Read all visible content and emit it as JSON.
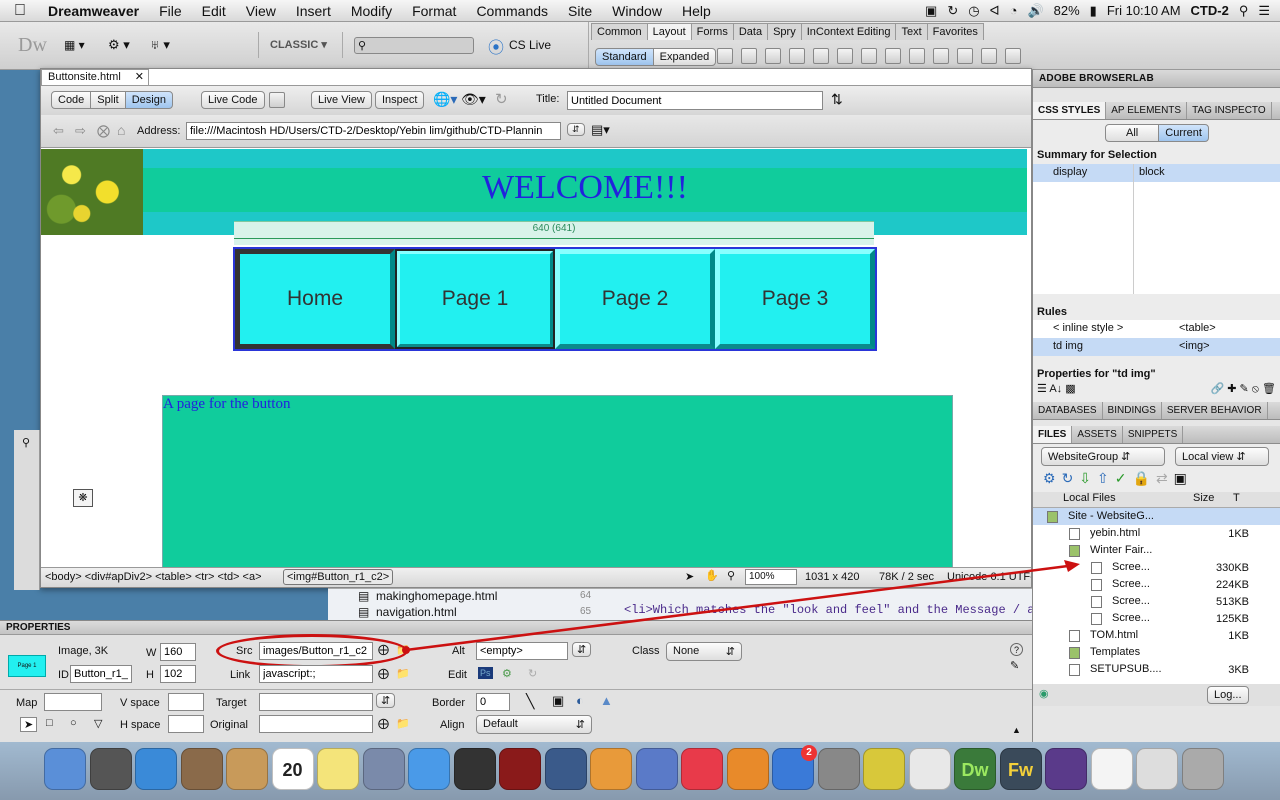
{
  "menubar": {
    "apple": "",
    "app": "Dreamweaver",
    "items": [
      "File",
      "Edit",
      "View",
      "Insert",
      "Modify",
      "Format",
      "Commands",
      "Site",
      "Window",
      "Help"
    ],
    "battery": "82%",
    "clock": "Fri 10:10 AM",
    "user": "CTD-2"
  },
  "apptoolbar": {
    "logo": "Dw",
    "workspace": "CLASSIC",
    "cslive": "CS Live"
  },
  "insertbar": {
    "tabs": [
      "Common",
      "Layout",
      "Forms",
      "Data",
      "Spry",
      "InContext Editing",
      "Text",
      "Favorites"
    ],
    "active_tab": "Layout",
    "modes": [
      "Standard",
      "Expanded"
    ]
  },
  "document": {
    "filename": "Buttonsite.html",
    "view_buttons": [
      "Code",
      "Split",
      "Design"
    ],
    "live_code": "Live Code",
    "live_view": "Live View",
    "inspect": "Inspect",
    "title_label": "Title:",
    "title_value": "Untitled Document",
    "address_label": "Address:",
    "address_value": "file:///Macintosh HD/Users/CTD-2/Desktop/Yebin lim/github/CTD-Plannin",
    "page": {
      "welcome": "WELCOME!!!",
      "table_width": "640 (641)",
      "buttons": [
        "Home",
        "Page 1",
        "Page 2",
        "Page 3"
      ],
      "caption": "A page for the button"
    },
    "status": {
      "tags": "<body> <div#apDiv2> <table> <tr> <td> <a> ",
      "selected_tag": "<img#Button_r1_c2>",
      "zoom": "100%",
      "size": "1031 x 420",
      "download": "78K / 2 sec",
      "encoding": "Unicode 6.1 UTF-"
    }
  },
  "background_code": {
    "files": [
      "makinghomepage.html",
      "navigation.html"
    ],
    "line_numbers": [
      "64",
      "65"
    ],
    "code": "<li>Which matches the \"look and feel\" and the Message / a"
  },
  "panels": {
    "browserlab": "ADOBE BROWSERLAB",
    "css_tabs": [
      "CSS STYLES",
      "AP ELEMENTS",
      "TAG INSPECTO"
    ],
    "css_modes": [
      "All",
      "Current"
    ],
    "summary_title": "Summary for Selection",
    "summary_row": {
      "prop": "display",
      "value": "block"
    },
    "rules_title": "Rules",
    "rules": [
      {
        "sel": "< inline style >",
        "tag": "<table>"
      },
      {
        "sel": "td img",
        "tag": "<img>"
      }
    ],
    "properties_for": "Properties for \"td img\"",
    "db_tabs": [
      "DATABASES",
      "BINDINGS",
      "SERVER BEHAVIOR"
    ],
    "files_tabs": [
      "FILES",
      "ASSETS",
      "SNIPPETS"
    ],
    "site_select": "WebsiteGroup",
    "view_select": "Local view",
    "col_local": "Local Files",
    "col_size": "Size",
    "col_t": "T",
    "tree": [
      {
        "name": "Site - WebsiteG...",
        "size": "",
        "indent": 0,
        "type": "site"
      },
      {
        "name": "yebin.html",
        "size": "1KB",
        "indent": 1,
        "type": "file"
      },
      {
        "name": "Winter Fair...",
        "size": "",
        "indent": 1,
        "type": "folder"
      },
      {
        "name": "Scree...",
        "size": "330KB",
        "indent": 2,
        "type": "file"
      },
      {
        "name": "Scree...",
        "size": "224KB",
        "indent": 2,
        "type": "file"
      },
      {
        "name": "Scree...",
        "size": "513KB",
        "indent": 2,
        "type": "file"
      },
      {
        "name": "Scree...",
        "size": "125KB",
        "indent": 2,
        "type": "file"
      },
      {
        "name": "TOM.html",
        "size": "1KB",
        "indent": 1,
        "type": "file"
      },
      {
        "name": "Templates",
        "size": "",
        "indent": 1,
        "type": "folder"
      },
      {
        "name": "SETUPSUB....",
        "size": "3KB",
        "indent": 1,
        "type": "file"
      }
    ],
    "log_button": "Log..."
  },
  "properties": {
    "header": "PROPERTIES",
    "thumb_text": "Page 1",
    "kind": "Image, 3K",
    "id_label": "ID",
    "id_value": "Button_r1_",
    "w_label": "W",
    "w_value": "160",
    "h_label": "H",
    "h_value": "102",
    "src_label": "Src",
    "src_value": "images/Button_r1_c2",
    "link_label": "Link",
    "link_value": "javascript:;",
    "alt_label": "Alt",
    "alt_value": "<empty>",
    "edit_label": "Edit",
    "class_label": "Class",
    "class_value": "None",
    "map_label": "Map",
    "vspace_label": "V space",
    "hspace_label": "H space",
    "target_label": "Target",
    "original_label": "Original",
    "border_label": "Border",
    "border_value": "0",
    "align_label": "Align",
    "align_value": "Default"
  },
  "dock": {
    "calendar_day": "20",
    "calendar_month": "MAR",
    "appstore_badge": "2",
    "apps": [
      "finder",
      "launchpad",
      "safari",
      "mail-bird",
      "contacts",
      "calendar",
      "stickies",
      "preview",
      "messages",
      "facetime",
      "photobooth",
      "iphoto",
      "pages",
      "keynote",
      "itunes",
      "ibooks",
      "app-store",
      "system-prefs",
      "wunderlist",
      "chrome",
      "dreamweaver",
      "fireworks",
      "github",
      "html-doc",
      "recent-docs",
      "trash"
    ],
    "dw_label": "Dw",
    "fw_label": "Fw"
  },
  "colors": {
    "welcome_bg": "#10cc9c",
    "banner_stripe": "#1ec8c8",
    "button_face": "#22f0f0",
    "welcome_text": "#2222dd",
    "caption_bg": "#10cc9c",
    "annotation_red": "#cc1111",
    "selection_blue": "#c5daf5"
  }
}
